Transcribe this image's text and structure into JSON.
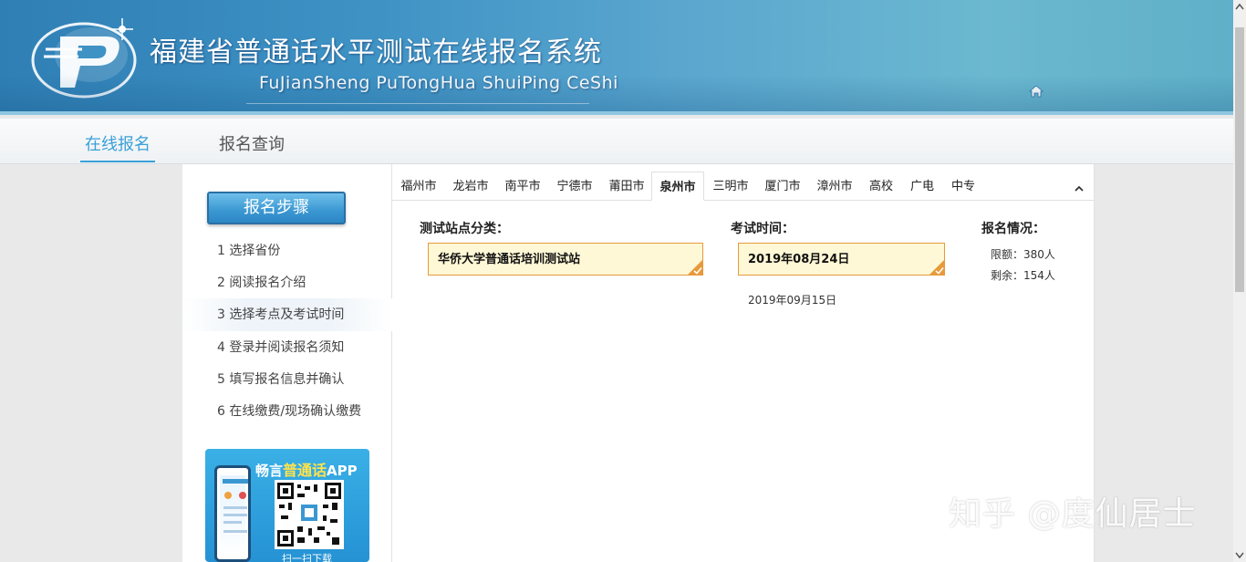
{
  "header": {
    "title_cn": "福建省普通话水平测试在线报名系统",
    "title_en": "FuJianSheng  PuTongHua ShuiPing CeShi",
    "home_icon": "home-icon"
  },
  "nav": {
    "tabs": [
      {
        "label": "在线报名",
        "active": true
      },
      {
        "label": "报名查询",
        "active": false
      }
    ]
  },
  "sidebar": {
    "steps_title": "报名步骤",
    "steps": [
      {
        "label": "1 选择省份"
      },
      {
        "label": "2 阅读报名介绍"
      },
      {
        "label": "3 选择考点及考试时间",
        "active": true
      },
      {
        "label": "4 登录并阅读报名须知"
      },
      {
        "label": "5 填写报名信息并确认"
      },
      {
        "label": "6 在线缴费/现场确认缴费"
      }
    ],
    "promo": {
      "title_prefix": "畅言",
      "title_highlight": "普通话",
      "title_suffix": "APP",
      "subtitle": "扫一扫下载"
    }
  },
  "main": {
    "cities": [
      {
        "label": "福州市"
      },
      {
        "label": "龙岩市"
      },
      {
        "label": "南平市"
      },
      {
        "label": "宁德市"
      },
      {
        "label": "莆田市"
      },
      {
        "label": "泉州市",
        "active": true
      },
      {
        "label": "三明市"
      },
      {
        "label": "厦门市"
      },
      {
        "label": "漳州市"
      },
      {
        "label": "高校"
      },
      {
        "label": "广电"
      },
      {
        "label": "中专"
      }
    ],
    "site_header": "测试站点分类：",
    "time_header": "考试时间：",
    "status_header": "报名情况：",
    "selected_site": "华侨大学普通话培训测试站",
    "selected_date": "2019年08月24日",
    "other_dates": [
      "2019年09月15日"
    ],
    "quota_label": "限额：380人",
    "remaining_label": "剩余：154人"
  },
  "watermark": "知乎 @度仙居士",
  "colors": {
    "accent": "#3aa0d8",
    "selection_bg": "#fff8d6",
    "selection_border": "#e89a3a"
  }
}
